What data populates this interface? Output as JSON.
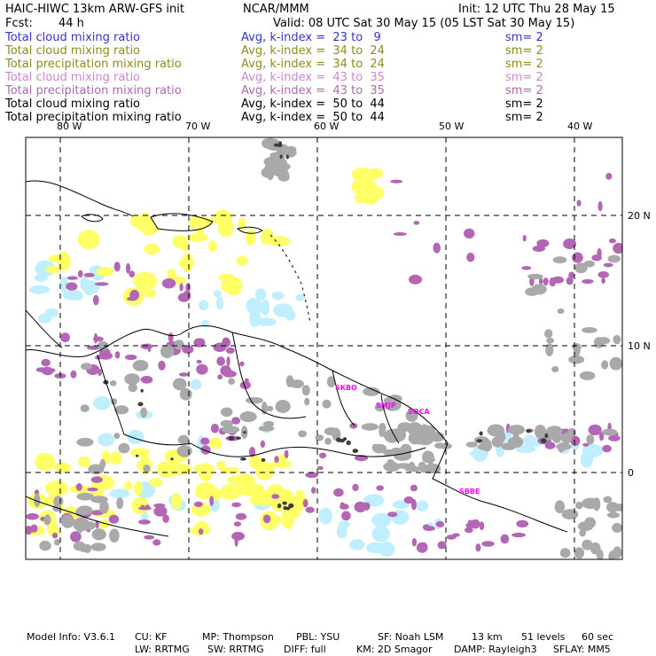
{
  "header": {
    "model": "HAIC-HIWC 13km ARW-GFS init",
    "org": "NCAR/MMM",
    "init": "Init: 12 UTC Thu 28 May 15",
    "fcst_label": "Fcst:",
    "fcst_value": "44 h",
    "valid": "Valid: 08 UTC Sat 30 May 15 (05 LST Sat 30 May 15)"
  },
  "legend": [
    {
      "name": "Total cloud mixing ratio",
      "avg": "Avg, k-index =  23 to   9",
      "sm": "sm= 2",
      "color": "#3333cc"
    },
    {
      "name": "Total cloud mixing ratio",
      "avg": "Avg, k-index =  34 to  24",
      "sm": "sm= 2",
      "color": "#8c8c1a"
    },
    {
      "name": "Total precipitation mixing ratio",
      "avg": "Avg, k-index =  34 to  24",
      "sm": "sm= 2",
      "color": "#8c8c1a"
    },
    {
      "name": "Total cloud mixing ratio",
      "avg": "Avg, k-index =  43 to  35",
      "sm": "sm= 2",
      "color": "#cc88cc"
    },
    {
      "name": "Total precipitation mixing ratio",
      "avg": "Avg, k-index =  43 to  35",
      "sm": "sm= 2",
      "color": "#b067b0"
    },
    {
      "name": "Total cloud mixing ratio",
      "avg": "Avg, k-index =  50 to  44",
      "sm": "sm= 2",
      "color": "#000000"
    },
    {
      "name": "Total precipitation mixing ratio",
      "avg": "Avg, k-index =  50 to  44",
      "sm": "sm= 2",
      "color": "#000000"
    }
  ],
  "axes": {
    "lon_labels": [
      "80 W",
      "70 W",
      "60 W",
      "50 W",
      "40 W"
    ],
    "lat_labels": [
      "20 N",
      "10 N",
      "0"
    ]
  },
  "sites": [
    "SKBO",
    "SMJP",
    "SOCA",
    "SBBE"
  ],
  "footer": {
    "line1": [
      "Model Info: V3.6.1",
      "CU: KF",
      "MP: Thompson",
      "PBL: YSU",
      "SF: Noah LSM",
      "13 km",
      "51 levels",
      "60 sec"
    ],
    "line2": [
      "LW: RRTMG",
      "SW: RRTMG",
      "DIFF: full",
      "KM: 2D Smagor",
      "DAMP: Rayleigh3",
      "SFLAY: MM5"
    ]
  },
  "colors": {
    "low_cloud": "#bfefff",
    "mid_cloud": "#ffff66",
    "high_cloud": "#b366b3",
    "deep_cloud": "#a9a9a9",
    "dark_core": "#3c3c3c",
    "site_label": "#ff00ff"
  }
}
